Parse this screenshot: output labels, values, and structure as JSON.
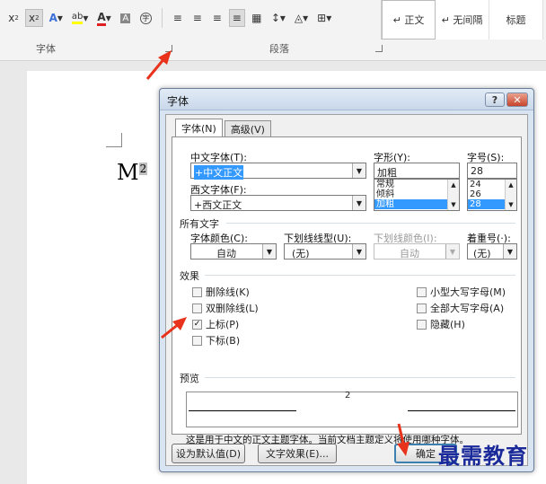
{
  "ribbon": {
    "font_group_label": "字体",
    "paragraph_group_label": "段落",
    "styles": [
      "↵ 正文",
      "↵ 无间隔",
      "标题"
    ]
  },
  "document": {
    "text": "M",
    "superscript": "2"
  },
  "dialog": {
    "title": "字体",
    "help_label": "?",
    "close_label": "✕",
    "tabs": [
      {
        "label": "字体(N)"
      },
      {
        "label": "高级(V)"
      }
    ],
    "cjk_font": {
      "label": "中文字体(T):",
      "value": "+中文正文"
    },
    "western_font": {
      "label": "西文字体(F):",
      "value": "+西文正文"
    },
    "style": {
      "label": "字形(Y):",
      "value": "加粗",
      "options": [
        "常规",
        "倾斜",
        "加粗"
      ]
    },
    "size": {
      "label": "字号(S):",
      "value": "28",
      "options": [
        "24",
        "26",
        "28"
      ]
    },
    "all_text": {
      "heading": "所有文字",
      "font_color": {
        "label": "字体颜色(C):",
        "value": "自动"
      },
      "underline_type": {
        "label": "下划线线型(U):",
        "value": "(无)"
      },
      "underline_color": {
        "label": "下划线颜色(I):",
        "value": "自动"
      },
      "emphasis": {
        "label": "着重号(·):",
        "value": "(无)"
      }
    },
    "effects": {
      "heading": "效果",
      "strikethrough": {
        "label": "删除线(K)",
        "checked": false
      },
      "double_strikethrough": {
        "label": "双删除线(L)",
        "checked": false
      },
      "superscript": {
        "label": "上标(P)",
        "checked": true
      },
      "subscript": {
        "label": "下标(B)",
        "checked": false
      },
      "small_caps": {
        "label": "小型大写字母(M)",
        "checked": false
      },
      "all_caps": {
        "label": "全部大写字母(A)",
        "checked": false
      },
      "hidden": {
        "label": "隐藏(H)",
        "checked": false
      }
    },
    "preview": {
      "heading": "预览",
      "sample": "2",
      "note": "这是用于中文的正文主题字体。当前文档主题定义将使用哪种字体。"
    },
    "buttons": {
      "set_default": "设为默认值(D)",
      "text_effects": "文字效果(E)...",
      "ok": "确定"
    }
  },
  "watermark": "最需教育",
  "colors": {
    "arrow": "#e8321c",
    "selection": "#3399ff",
    "watermark": "#1b2a9a"
  }
}
